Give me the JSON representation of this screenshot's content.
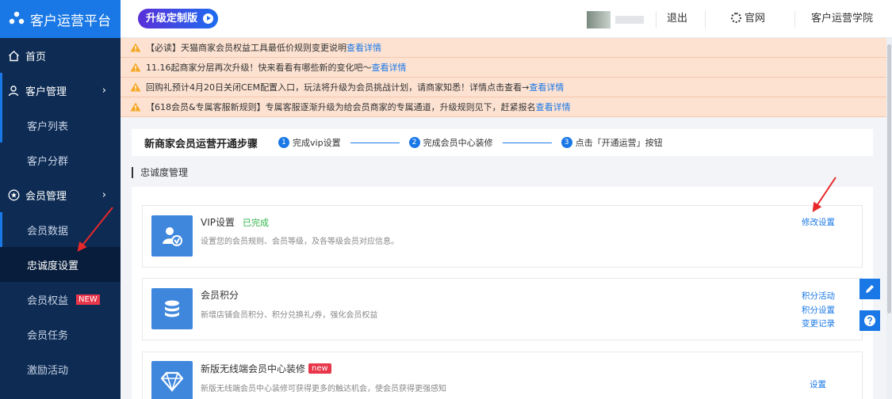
{
  "app": {
    "title": "客户运营平台",
    "upgrade_label": "升级定制版"
  },
  "header": {
    "logout": "退出",
    "official_site": "官网",
    "academy": "客户运营学院"
  },
  "sidebar": {
    "home": "首页",
    "customer_mgmt": "客户管理",
    "customer_list": "客户列表",
    "customer_group": "客户分群",
    "member_mgmt": "会员管理",
    "member_data": "会员数据",
    "loyalty_settings": "忠诚度设置",
    "member_rights": "会员权益",
    "new_tag": "NEW",
    "member_tasks": "会员任务",
    "incentive": "激励活动"
  },
  "notices": [
    {
      "text": "【必读】天猫商家会员权益工具最低价规则变更说明",
      "link": "查看详情"
    },
    {
      "text": "11.16起商家分层再次升级！快来看看有哪些新的变化吧～",
      "link": "查看详情"
    },
    {
      "text": "回购礼预计4月20日关闭CEM配置入口，玩法将升级为会员挑战计划，请商家知悉！详情点击查看→",
      "link": "查看详情"
    },
    {
      "text": "【618会员&专属客服新规则】专属客服逐渐升级为给会员商家的专属通道，升级规则见下，赶紧报名",
      "link": "查看详情"
    }
  ],
  "steps": {
    "title": "新商家会员运营开通步骤",
    "items": [
      {
        "num": "1",
        "label": "完成vip设置"
      },
      {
        "num": "2",
        "label": "完成会员中心装修"
      },
      {
        "num": "3",
        "label": "点击「开通运营」按钮"
      }
    ]
  },
  "section_title": "忠诚度管理",
  "cards": [
    {
      "title": "VIP设置",
      "status": "已完成",
      "desc": "设置您的会员规则、会员等级，及各等级会员对应信息。",
      "links": [
        "修改设置"
      ]
    },
    {
      "title": "会员积分",
      "desc": "新增店铺会员积分、积分兑换礼/券，强化会员权益",
      "links": [
        "积分活动",
        "积分设置",
        "变更记录"
      ]
    },
    {
      "title": "新版无线端会员中心装修",
      "badge": "new",
      "desc": "新版无线端会员中心装修可获得更多的触达机会，使会员获得更强感知",
      "links": [
        "设置"
      ]
    }
  ],
  "colors": {
    "primary": "#1a78e6",
    "sidebar_bg": "#0d2b53",
    "notice_bg": "#fde2d2",
    "arrow": "#e8282b"
  }
}
